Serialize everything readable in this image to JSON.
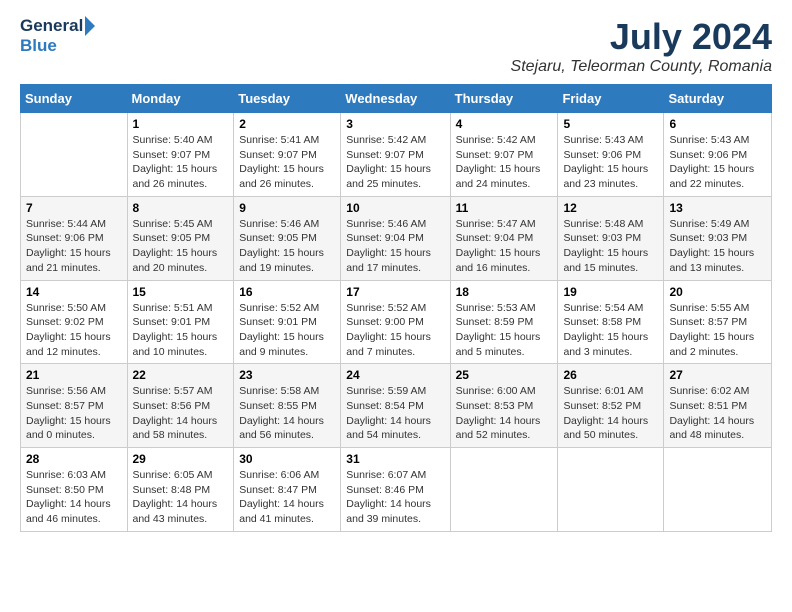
{
  "logo": {
    "general": "General",
    "blue": "Blue"
  },
  "title": "July 2024",
  "subtitle": "Stejaru, Teleorman County, Romania",
  "days_of_week": [
    "Sunday",
    "Monday",
    "Tuesday",
    "Wednesday",
    "Thursday",
    "Friday",
    "Saturday"
  ],
  "weeks": [
    [
      {
        "num": "",
        "sunrise": "",
        "sunset": "",
        "daylight": ""
      },
      {
        "num": "1",
        "sunrise": "Sunrise: 5:40 AM",
        "sunset": "Sunset: 9:07 PM",
        "daylight": "Daylight: 15 hours and 26 minutes."
      },
      {
        "num": "2",
        "sunrise": "Sunrise: 5:41 AM",
        "sunset": "Sunset: 9:07 PM",
        "daylight": "Daylight: 15 hours and 26 minutes."
      },
      {
        "num": "3",
        "sunrise": "Sunrise: 5:42 AM",
        "sunset": "Sunset: 9:07 PM",
        "daylight": "Daylight: 15 hours and 25 minutes."
      },
      {
        "num": "4",
        "sunrise": "Sunrise: 5:42 AM",
        "sunset": "Sunset: 9:07 PM",
        "daylight": "Daylight: 15 hours and 24 minutes."
      },
      {
        "num": "5",
        "sunrise": "Sunrise: 5:43 AM",
        "sunset": "Sunset: 9:06 PM",
        "daylight": "Daylight: 15 hours and 23 minutes."
      },
      {
        "num": "6",
        "sunrise": "Sunrise: 5:43 AM",
        "sunset": "Sunset: 9:06 PM",
        "daylight": "Daylight: 15 hours and 22 minutes."
      }
    ],
    [
      {
        "num": "7",
        "sunrise": "Sunrise: 5:44 AM",
        "sunset": "Sunset: 9:06 PM",
        "daylight": "Daylight: 15 hours and 21 minutes."
      },
      {
        "num": "8",
        "sunrise": "Sunrise: 5:45 AM",
        "sunset": "Sunset: 9:05 PM",
        "daylight": "Daylight: 15 hours and 20 minutes."
      },
      {
        "num": "9",
        "sunrise": "Sunrise: 5:46 AM",
        "sunset": "Sunset: 9:05 PM",
        "daylight": "Daylight: 15 hours and 19 minutes."
      },
      {
        "num": "10",
        "sunrise": "Sunrise: 5:46 AM",
        "sunset": "Sunset: 9:04 PM",
        "daylight": "Daylight: 15 hours and 17 minutes."
      },
      {
        "num": "11",
        "sunrise": "Sunrise: 5:47 AM",
        "sunset": "Sunset: 9:04 PM",
        "daylight": "Daylight: 15 hours and 16 minutes."
      },
      {
        "num": "12",
        "sunrise": "Sunrise: 5:48 AM",
        "sunset": "Sunset: 9:03 PM",
        "daylight": "Daylight: 15 hours and 15 minutes."
      },
      {
        "num": "13",
        "sunrise": "Sunrise: 5:49 AM",
        "sunset": "Sunset: 9:03 PM",
        "daylight": "Daylight: 15 hours and 13 minutes."
      }
    ],
    [
      {
        "num": "14",
        "sunrise": "Sunrise: 5:50 AM",
        "sunset": "Sunset: 9:02 PM",
        "daylight": "Daylight: 15 hours and 12 minutes."
      },
      {
        "num": "15",
        "sunrise": "Sunrise: 5:51 AM",
        "sunset": "Sunset: 9:01 PM",
        "daylight": "Daylight: 15 hours and 10 minutes."
      },
      {
        "num": "16",
        "sunrise": "Sunrise: 5:52 AM",
        "sunset": "Sunset: 9:01 PM",
        "daylight": "Daylight: 15 hours and 9 minutes."
      },
      {
        "num": "17",
        "sunrise": "Sunrise: 5:52 AM",
        "sunset": "Sunset: 9:00 PM",
        "daylight": "Daylight: 15 hours and 7 minutes."
      },
      {
        "num": "18",
        "sunrise": "Sunrise: 5:53 AM",
        "sunset": "Sunset: 8:59 PM",
        "daylight": "Daylight: 15 hours and 5 minutes."
      },
      {
        "num": "19",
        "sunrise": "Sunrise: 5:54 AM",
        "sunset": "Sunset: 8:58 PM",
        "daylight": "Daylight: 15 hours and 3 minutes."
      },
      {
        "num": "20",
        "sunrise": "Sunrise: 5:55 AM",
        "sunset": "Sunset: 8:57 PM",
        "daylight": "Daylight: 15 hours and 2 minutes."
      }
    ],
    [
      {
        "num": "21",
        "sunrise": "Sunrise: 5:56 AM",
        "sunset": "Sunset: 8:57 PM",
        "daylight": "Daylight: 15 hours and 0 minutes."
      },
      {
        "num": "22",
        "sunrise": "Sunrise: 5:57 AM",
        "sunset": "Sunset: 8:56 PM",
        "daylight": "Daylight: 14 hours and 58 minutes."
      },
      {
        "num": "23",
        "sunrise": "Sunrise: 5:58 AM",
        "sunset": "Sunset: 8:55 PM",
        "daylight": "Daylight: 14 hours and 56 minutes."
      },
      {
        "num": "24",
        "sunrise": "Sunrise: 5:59 AM",
        "sunset": "Sunset: 8:54 PM",
        "daylight": "Daylight: 14 hours and 54 minutes."
      },
      {
        "num": "25",
        "sunrise": "Sunrise: 6:00 AM",
        "sunset": "Sunset: 8:53 PM",
        "daylight": "Daylight: 14 hours and 52 minutes."
      },
      {
        "num": "26",
        "sunrise": "Sunrise: 6:01 AM",
        "sunset": "Sunset: 8:52 PM",
        "daylight": "Daylight: 14 hours and 50 minutes."
      },
      {
        "num": "27",
        "sunrise": "Sunrise: 6:02 AM",
        "sunset": "Sunset: 8:51 PM",
        "daylight": "Daylight: 14 hours and 48 minutes."
      }
    ],
    [
      {
        "num": "28",
        "sunrise": "Sunrise: 6:03 AM",
        "sunset": "Sunset: 8:50 PM",
        "daylight": "Daylight: 14 hours and 46 minutes."
      },
      {
        "num": "29",
        "sunrise": "Sunrise: 6:05 AM",
        "sunset": "Sunset: 8:48 PM",
        "daylight": "Daylight: 14 hours and 43 minutes."
      },
      {
        "num": "30",
        "sunrise": "Sunrise: 6:06 AM",
        "sunset": "Sunset: 8:47 PM",
        "daylight": "Daylight: 14 hours and 41 minutes."
      },
      {
        "num": "31",
        "sunrise": "Sunrise: 6:07 AM",
        "sunset": "Sunset: 8:46 PM",
        "daylight": "Daylight: 14 hours and 39 minutes."
      },
      {
        "num": "",
        "sunrise": "",
        "sunset": "",
        "daylight": ""
      },
      {
        "num": "",
        "sunrise": "",
        "sunset": "",
        "daylight": ""
      },
      {
        "num": "",
        "sunrise": "",
        "sunset": "",
        "daylight": ""
      }
    ]
  ]
}
